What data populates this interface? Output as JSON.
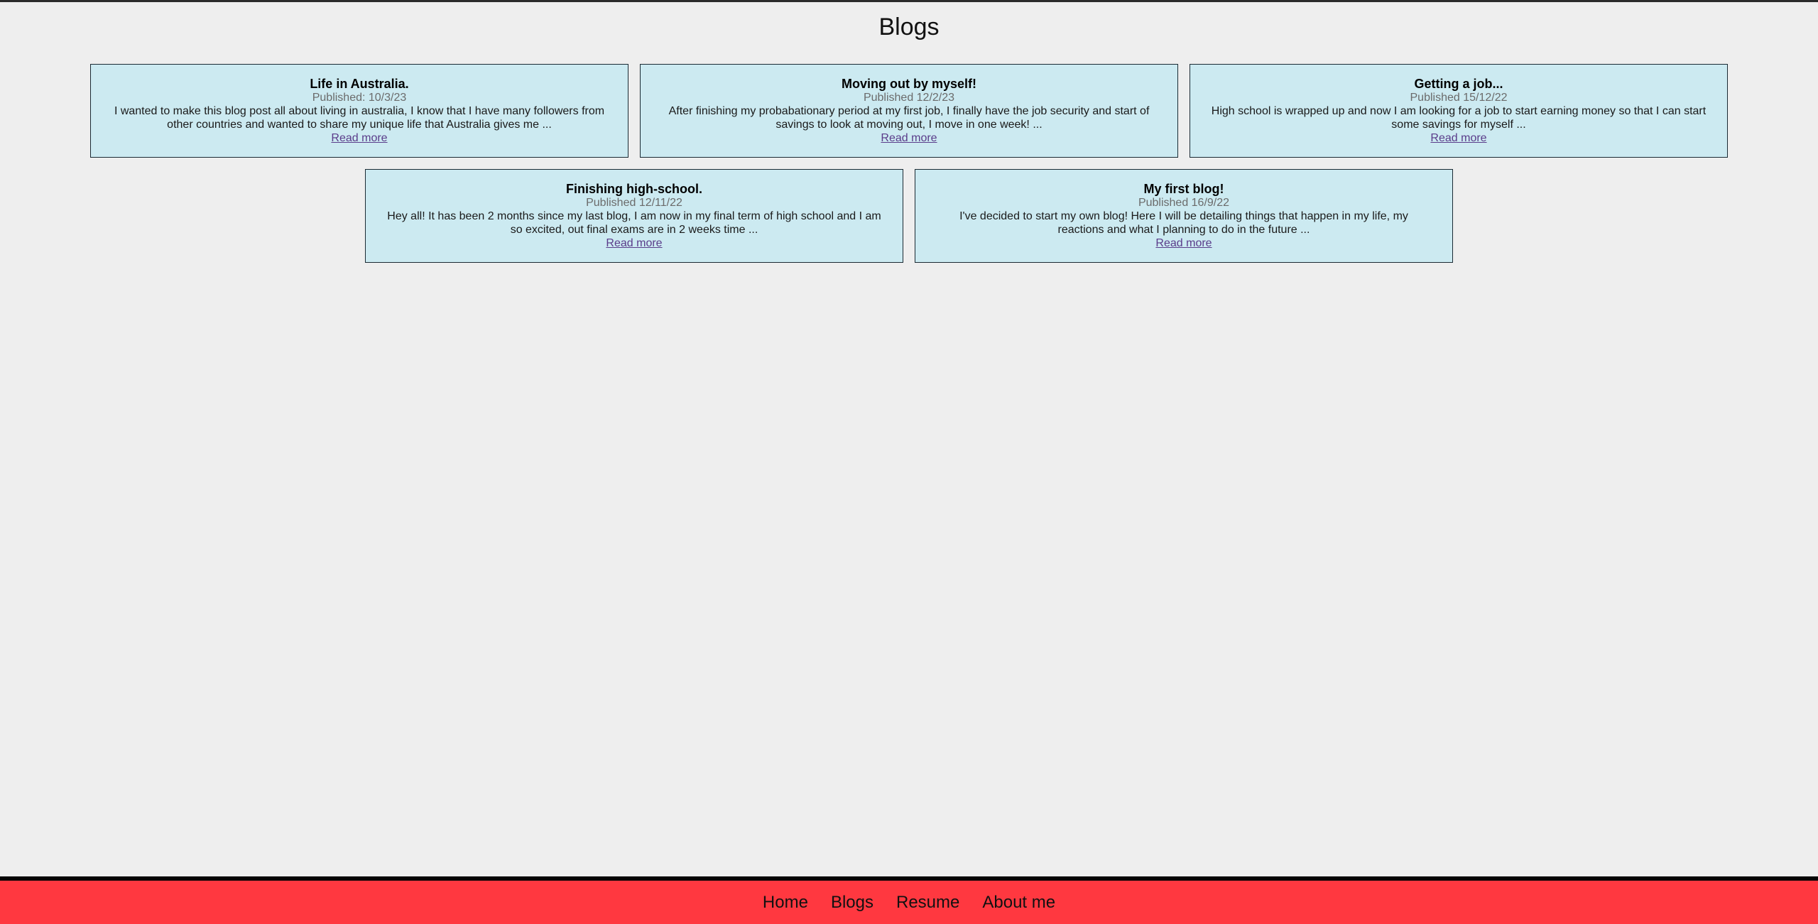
{
  "page": {
    "title": "Blogs"
  },
  "posts": [
    {
      "title": "Life in Australia.",
      "date": "Published: 10/3/23",
      "excerpt": "I wanted to make this blog post all about living in australia, I know that I have many followers from other countries and wanted to share my unique life that Australia gives me ...",
      "link": "Read more"
    },
    {
      "title": "Moving out by myself!",
      "date": "Published 12/2/23",
      "excerpt": "After finishing my probabationary period at my first job, I finally have the job security and start of savings to look at moving out, I move in one week! ...",
      "link": "Read more"
    },
    {
      "title": "Getting a job...",
      "date": "Published 15/12/22",
      "excerpt": "High school is wrapped up and now I am looking for a job to start earning money so that I can start some savings for myself ...",
      "link": "Read more"
    },
    {
      "title": "Finishing high-school.",
      "date": "Published 12/11/22",
      "excerpt": "Hey all! It has been 2 months since my last blog, I am now in my final term of high school and I am so excited, out final exams are in 2 weeks time ...",
      "link": "Read more"
    },
    {
      "title": "My first blog!",
      "date": "Published 16/9/22",
      "excerpt": "I've decided to start my own blog! Here I will be detailing things that happen in my life, my reactions and what I planning to do in the future ...",
      "link": "Read more"
    }
  ],
  "footer": {
    "links": [
      "Home",
      "Blogs",
      "Resume",
      "About me"
    ]
  },
  "colors": {
    "background": "#eeeeee",
    "card": "#cceaf1",
    "footer": "#ff3840",
    "link": "#5a3c8a"
  }
}
